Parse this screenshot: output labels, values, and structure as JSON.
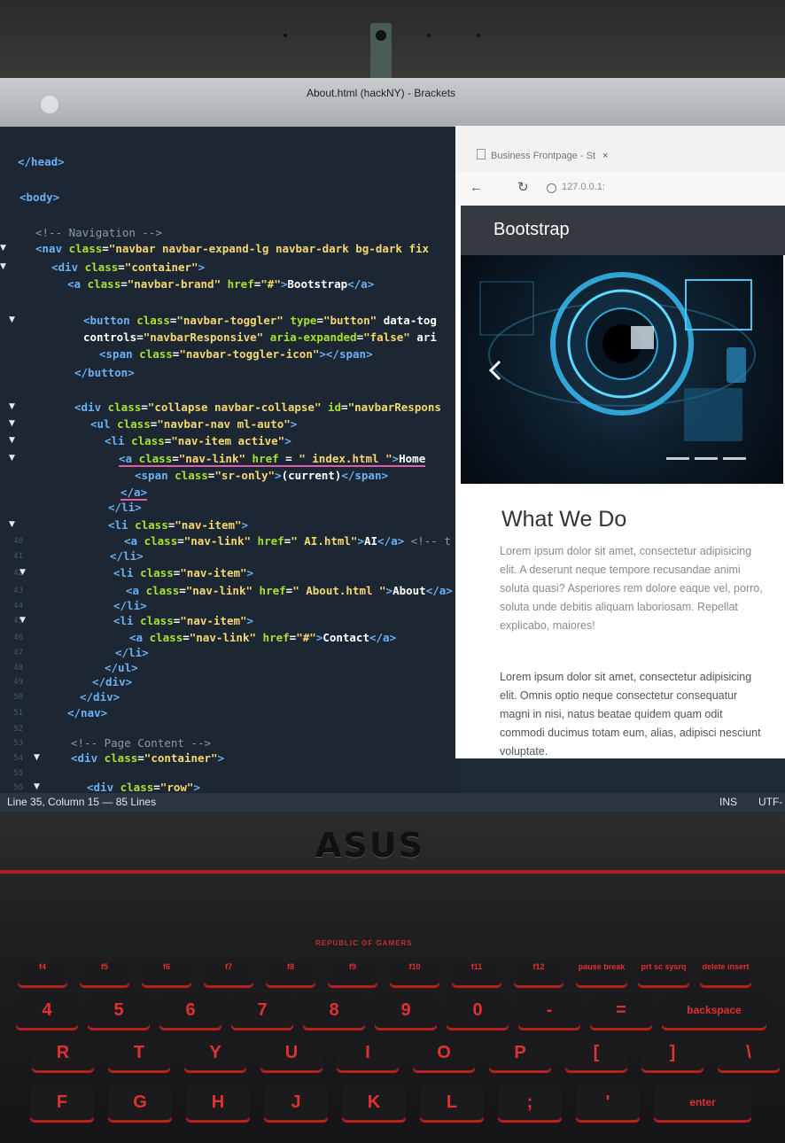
{
  "window": {
    "title": "About.html (hackNY) - Brackets"
  },
  "editor": {
    "lines": [
      {
        "n": "",
        "t": "</head>"
      },
      {
        "n": "",
        "t": "<body>"
      },
      {
        "n": "",
        "t": "<!-- Navigation -->"
      },
      {
        "n": "",
        "t": "<nav class=\"navbar navbar-expand-lg navbar-dark bg-dark fix"
      },
      {
        "n": "",
        "t": "<div class=\"container\">"
      },
      {
        "n": "",
        "t": "<a class=\"navbar-brand\" href=\"#\">Bootstrap</a>"
      },
      {
        "n": "",
        "t": "<button class=\"navbar-toggler\" type=\"button\" data-tog"
      },
      {
        "n": "",
        "t": "controls=\"navbarResponsive\" aria-expanded=\"false\" ari"
      },
      {
        "n": "",
        "t": "<span class=\"navbar-toggler-icon\"></span>"
      },
      {
        "n": "",
        "t": "</button>"
      },
      {
        "n": "",
        "t": "<div class=\"collapse navbar-collapse\" id=\"navbarRespons"
      },
      {
        "n": "",
        "t": "<ul class=\"navbar-nav ml-auto\">"
      },
      {
        "n": "",
        "t": "<li class=\"nav-item active\">"
      },
      {
        "n": "",
        "t": "<a class=\"nav-link\" href = \" index.html \">Home"
      },
      {
        "n": "",
        "t": "<span class=\"sr-only\">(current)</span>"
      },
      {
        "n": "",
        "t": "</a>"
      },
      {
        "n": "",
        "t": "</li>"
      },
      {
        "n": "",
        "t": "<li class=\"nav-item\">"
      },
      {
        "n": "40",
        "t": "<a class=\"nav-link\" href=\" AI.html\">AI</a> <!-- t"
      },
      {
        "n": "41",
        "t": "</li>"
      },
      {
        "n": "42",
        "t": "<li class=\"nav-item\">"
      },
      {
        "n": "43",
        "t": "<a class=\"nav-link\" href=\" About.html \">About</a>"
      },
      {
        "n": "44",
        "t": "</li>"
      },
      {
        "n": "45",
        "t": "<li class=\"nav-item\">"
      },
      {
        "n": "46",
        "t": "<a class=\"nav-link\" href=\"#\">Contact</a>"
      },
      {
        "n": "47",
        "t": "</li>"
      },
      {
        "n": "48",
        "t": "</ul>"
      },
      {
        "n": "49",
        "t": "</div>"
      },
      {
        "n": "50",
        "t": "</div>"
      },
      {
        "n": "51",
        "t": "</nav>"
      },
      {
        "n": "52",
        "t": ""
      },
      {
        "n": "53",
        "t": "<!-- Page Content -->"
      },
      {
        "n": "54",
        "t": "<div class=\"container\">"
      },
      {
        "n": "55",
        "t": ""
      },
      {
        "n": "56",
        "t": "<div class=\"row\">"
      }
    ]
  },
  "statusbar": {
    "position": "Line 35, Column 15 — 85 Lines",
    "mode": "INS",
    "encoding": "UTF-"
  },
  "browser": {
    "tab_title": "Business Frontpage - St",
    "tab_close": "×",
    "url": "127.0.0.1:",
    "brand": "Bootstrap",
    "heading": "What We Do",
    "para1": "Lorem ipsum dolor sit amet, consectetur adipisicing elit. A deserunt neque tempore recusandae animi soluta quasi? Asperiores rem dolore eaque vel, porro, soluta unde debitis aliquam laboriosam. Repellat explicabo, maiores!",
    "para2": "Lorem ipsum dolor sit amet, consectetur adipisicing elit. Omnis optio neque consectetur consequatur magni in nisi, natus beatae quidem quam odit commodi ducimus totam eum, alias, adipisci nesciunt voluptate."
  },
  "laptop": {
    "brand": "ASUS",
    "series": "REPUBLIC OF GAMERS"
  },
  "keyboard": {
    "fkeys": [
      "f4",
      "f5",
      "f6",
      "f7",
      "f8",
      "f9",
      "f10",
      "f11",
      "f12",
      "pause break",
      "prt sc sysrq",
      "delete insert"
    ],
    "numrow": [
      "4",
      "5",
      "6",
      "7",
      "8",
      "9",
      "0",
      "-",
      "=",
      "backspace"
    ],
    "toprow": [
      "R",
      "T",
      "Y",
      "U",
      "I",
      "O",
      "P",
      "[",
      "]",
      "\\"
    ],
    "homerow": [
      "F",
      "G",
      "H",
      "J",
      "K",
      "L",
      ";",
      "'",
      "enter"
    ]
  },
  "colors": {
    "editor_bg": "#1d2733",
    "tag": "#6ab0f3",
    "attr": "#a6e22e",
    "string": "#f5d76e",
    "key_glow": "#b82020"
  }
}
